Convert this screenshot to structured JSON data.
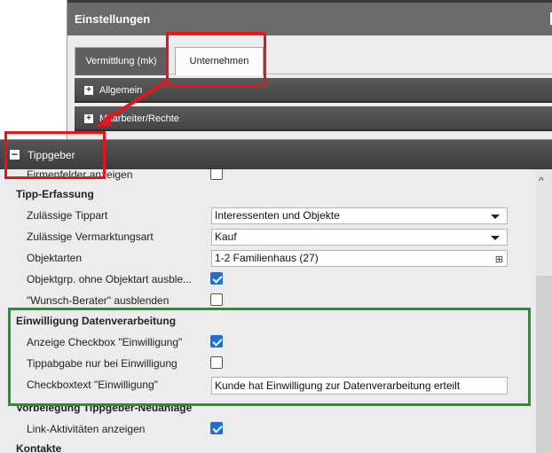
{
  "dialog": {
    "title": "Einstellungen",
    "close_glyph": "×"
  },
  "tabs": [
    {
      "label": "Vermittlung (mk)"
    },
    {
      "label": "Unternehmen"
    }
  ],
  "sections": {
    "allgemein": "Allgemein",
    "mitarbeiter": "Mitarbeiter/Rechte",
    "tippgeber": "Tippgeber"
  },
  "icons": {
    "expand": "+",
    "collapse": "−",
    "tree": "⊞",
    "scroll_up": "^"
  },
  "rows": {
    "firmenfelder": "Firmenfelder anzeigen",
    "tipp_erfassung": "Tipp-Erfassung",
    "zulaessige_tippart": "Zulässige Tippart",
    "tippart_value": "Interessenten und Objekte",
    "vermarktungsart": "Zulässige Vermarktungsart",
    "vermarktungsart_value": "Kauf",
    "objektarten": "Objektarten",
    "objektarten_value": "1-2 Familienhaus (27)",
    "objektgrp": "Objektgrp. ohne Objektart ausble...",
    "wunsch_berater": "\"Wunsch-Berater\" ausblenden",
    "einwilligung_head": "Einwilligung Datenverarbeitung",
    "anzeige_checkbox": "Anzeige Checkbox \"Einwilligung\"",
    "tippabgabe": "Tippabgabe nur bei Einwilligung",
    "checkboxtext": "Checkboxtext \"Einwilligung\"",
    "checkboxtext_value": "Kunde hat Einwilligung zur Datenverarbeitung erteilt",
    "vorbelegung_head": "Vorbelegung Tippgeber-Neuanlage",
    "link_aktivitaeten": "Link-Aktivitäten anzeigen",
    "kontakte_head": "Kontakte"
  },
  "checkbox_states": {
    "firmenfelder": false,
    "objektgrp": true,
    "wunsch_berater": false,
    "anzeige_checkbox": true,
    "tippabgabe": false,
    "link_aktivitaeten": true
  },
  "colors": {
    "annotation_red": "#e8141a",
    "annotation_green": "#1a9a2a",
    "checkbox_blue": "#1f6fd6"
  }
}
